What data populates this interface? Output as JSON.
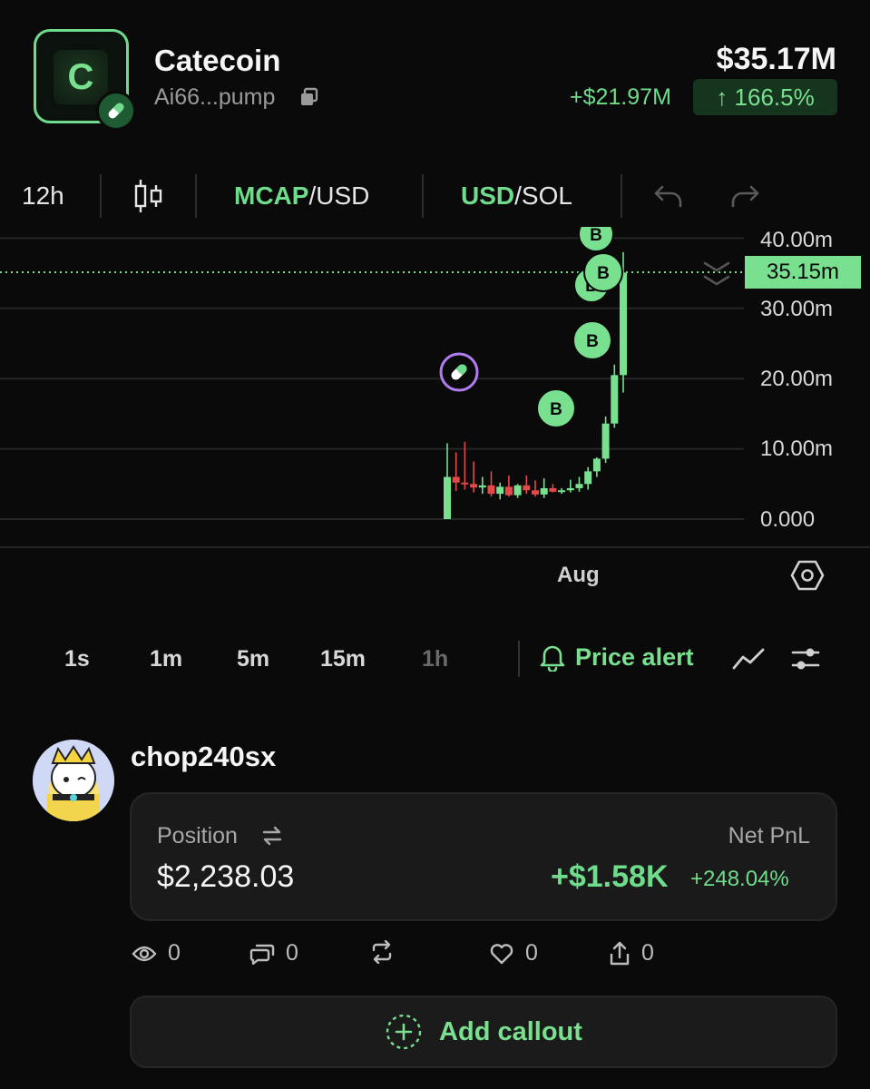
{
  "token": {
    "logo_letter": "C",
    "name": "Catecoin",
    "address": "Ai66...pump",
    "market_cap": "$35.17M",
    "change_abs": "+$21.97M",
    "change_pct": "↑ 166.5%"
  },
  "toolbar": {
    "interval": "12h",
    "mcap_strong": "MCAP",
    "mcap_rest": "/USD",
    "currency_strong": "USD",
    "currency_rest": "/SOL"
  },
  "chart_data": {
    "type": "candlestick",
    "y_ticks": [
      "40.00m",
      "30.00m",
      "20.00m",
      "10.00m",
      "0.000"
    ],
    "ylim": [
      0,
      40
    ],
    "x_ticks": [
      "Aug"
    ],
    "current_price": "35.15m",
    "current_value": 35.15,
    "trade_marker_label": "B",
    "candles": [
      {
        "o": 0,
        "h": 10.8,
        "l": 0,
        "c": 6.0
      },
      {
        "o": 6.0,
        "h": 9.5,
        "l": 4.0,
        "c": 5.2
      },
      {
        "o": 5.2,
        "h": 11.0,
        "l": 4.2,
        "c": 5.0
      },
      {
        "o": 5.0,
        "h": 8.2,
        "l": 3.8,
        "c": 4.5
      },
      {
        "o": 4.5,
        "h": 6.0,
        "l": 3.6,
        "c": 4.8
      },
      {
        "o": 4.8,
        "h": 6.8,
        "l": 3.2,
        "c": 3.6
      },
      {
        "o": 3.6,
        "h": 5.2,
        "l": 2.8,
        "c": 4.6
      },
      {
        "o": 4.6,
        "h": 6.2,
        "l": 3.2,
        "c": 3.4
      },
      {
        "o": 3.4,
        "h": 5.0,
        "l": 3.0,
        "c": 4.8
      },
      {
        "o": 4.8,
        "h": 6.2,
        "l": 3.6,
        "c": 4.1
      },
      {
        "o": 4.1,
        "h": 5.5,
        "l": 3.2,
        "c": 3.5
      },
      {
        "o": 3.5,
        "h": 5.8,
        "l": 3.0,
        "c": 4.4
      },
      {
        "o": 4.4,
        "h": 5.0,
        "l": 3.8,
        "c": 3.9
      },
      {
        "o": 3.9,
        "h": 4.4,
        "l": 3.6,
        "c": 4.1
      },
      {
        "o": 4.1,
        "h": 5.6,
        "l": 3.8,
        "c": 4.4
      },
      {
        "o": 4.4,
        "h": 6.0,
        "l": 3.9,
        "c": 5.0
      },
      {
        "o": 5.0,
        "h": 7.4,
        "l": 4.2,
        "c": 6.8
      },
      {
        "o": 6.8,
        "h": 8.8,
        "l": 6.0,
        "c": 8.6
      },
      {
        "o": 8.6,
        "h": 14.6,
        "l": 8.0,
        "c": 13.6
      },
      {
        "o": 13.6,
        "h": 22.0,
        "l": 13.0,
        "c": 20.5
      },
      {
        "o": 20.5,
        "h": 38.0,
        "l": 18.0,
        "c": 35.1
      }
    ]
  },
  "timeframes": [
    "1s",
    "1m",
    "5m",
    "15m",
    "1h"
  ],
  "price_alert_label": "Price alert",
  "post": {
    "username": "chop240sx",
    "position_label": "Position",
    "position_value": "$2,238.03",
    "pnl_label": "Net PnL",
    "pnl_value": "+$1.58K",
    "pnl_pct": "+248.04%",
    "views": "0",
    "comments": "0",
    "likes": "0",
    "shares": "0"
  },
  "callout_label": "Add callout",
  "colors": {
    "accent": "#79e08f",
    "up": "#79e08f",
    "down": "#e24a4a",
    "background": "#0a0a0a"
  }
}
